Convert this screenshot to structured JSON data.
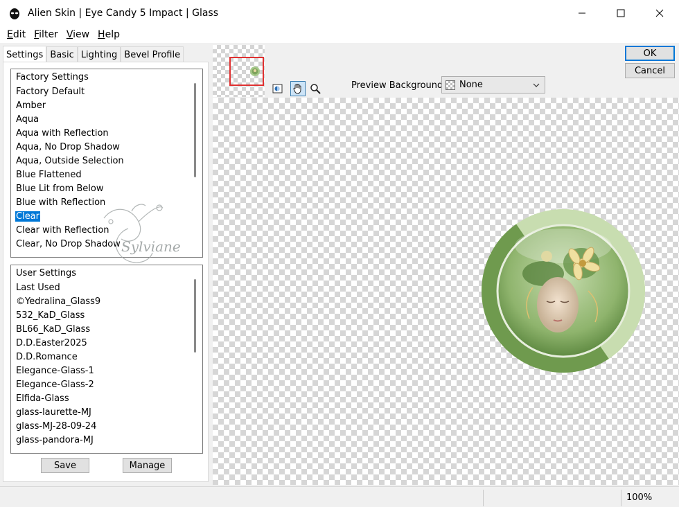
{
  "window": {
    "title": "Alien Skin | Eye Candy 5 Impact | Glass"
  },
  "menu": [
    {
      "u": "E",
      "rest": "dit"
    },
    {
      "u": "F",
      "rest": "ilter"
    },
    {
      "u": "V",
      "rest": "iew"
    },
    {
      "u": "H",
      "rest": "elp"
    }
  ],
  "tabs": [
    "Settings",
    "Basic",
    "Lighting",
    "Bevel Profile"
  ],
  "factory": {
    "header": "Factory Settings",
    "items": [
      "Factory Default",
      "Amber",
      "Aqua",
      "Aqua with Reflection",
      "Aqua, No Drop Shadow",
      "Aqua, Outside Selection",
      "Blue Flattened",
      "Blue Lit from Below",
      "Blue with Reflection",
      "Clear",
      "Clear with Reflection",
      "Clear, No Drop Shadow"
    ],
    "selected": "Clear"
  },
  "user": {
    "header": "User Settings",
    "items": [
      "Last Used",
      "©Yedralina_Glass9",
      "532_KaD_Glass",
      "BL66_KaD_Glass",
      "D.D.Easter2025",
      "D.D.Romance",
      "Elegance-Glass-1",
      "Elegance-Glass-2",
      "Elfida-Glass",
      "glass-laurette-MJ",
      "glass-MJ-28-09-24",
      "glass-pandora-MJ"
    ]
  },
  "buttons": {
    "save": "Save",
    "manage": "Manage",
    "ok": "OK",
    "cancel": "Cancel"
  },
  "preview_background": {
    "label": "Preview Background:",
    "value": "None"
  },
  "status": {
    "zoom": "100%"
  },
  "watermark": "Sylviane",
  "colors": {
    "selection": "#0078d7",
    "nav_frame": "#e03030",
    "medallion_ring": "#a6c98a",
    "medallion_dark": "#6f9a4e"
  }
}
